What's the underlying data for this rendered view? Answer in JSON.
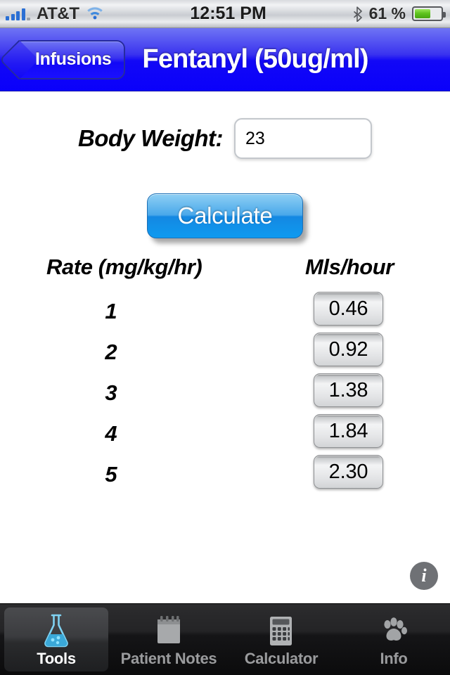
{
  "statusbar": {
    "carrier": "AT&T",
    "time": "12:51 PM",
    "battery_percent": "61 %",
    "battery_level": 61,
    "signal_bars": 4,
    "wifi_icon": "wifi-icon",
    "bluetooth_icon": "bluetooth-icon",
    "battery_icon": "battery-icon"
  },
  "navbar": {
    "back_label": "Infusions",
    "title": "Fentanyl (50ug/ml)",
    "accent_color": "#1208f6"
  },
  "form": {
    "weight_label": "Body Weight:",
    "weight_value": "23",
    "weight_placeholder": "",
    "calculate_label": "Calculate"
  },
  "results": {
    "col_rate_header": "Rate (mg/kg/hr)",
    "col_mls_header": "Mls/hour",
    "rows": [
      {
        "rate": "1",
        "mls": "0.46"
      },
      {
        "rate": "2",
        "mls": "0.92"
      },
      {
        "rate": "3",
        "mls": "1.38"
      },
      {
        "rate": "4",
        "mls": "1.84"
      },
      {
        "rate": "5",
        "mls": "2.30"
      }
    ]
  },
  "info_button": {
    "glyph": "i",
    "icon": "info-icon"
  },
  "tabbar": {
    "items": [
      {
        "label": "Tools",
        "icon": "flask-icon",
        "active": true
      },
      {
        "label": "Patient Notes",
        "icon": "notepad-icon",
        "active": false
      },
      {
        "label": "Calculator",
        "icon": "calculator-icon",
        "active": false
      },
      {
        "label": "Info",
        "icon": "paw-icon",
        "active": false
      }
    ]
  }
}
